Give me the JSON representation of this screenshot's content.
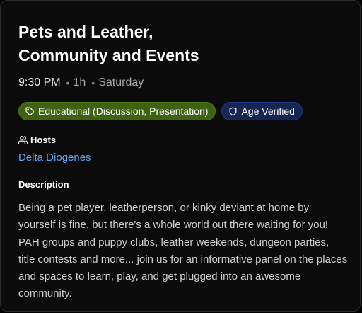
{
  "event": {
    "title": "Pets and Leather,\nCommunity and Events",
    "time": "9:30 PM",
    "duration": "1h",
    "day": "Saturday"
  },
  "badges": {
    "category": {
      "label": "Educational (Discussion, Presentation)",
      "icon": "tag-icon",
      "color": "#3f6212"
    },
    "verification": {
      "label": "Age Verified",
      "icon": "shield-icon",
      "color": "#172554"
    }
  },
  "hosts": {
    "label": "Hosts",
    "icon": "users-icon",
    "names": [
      "Delta Diogenes"
    ],
    "link_color": "#60a5fa"
  },
  "description": {
    "label": "Description",
    "text": "Being a pet player, leatherperson, or kinky deviant at home by yourself is fine, but there's a whole world out there waiting for you! PAH groups and puppy clubs, leather weekends, dungeon parties, title contests and more... join us for an informative panel on the places and spaces to learn, play, and get plugged into an awesome community."
  }
}
